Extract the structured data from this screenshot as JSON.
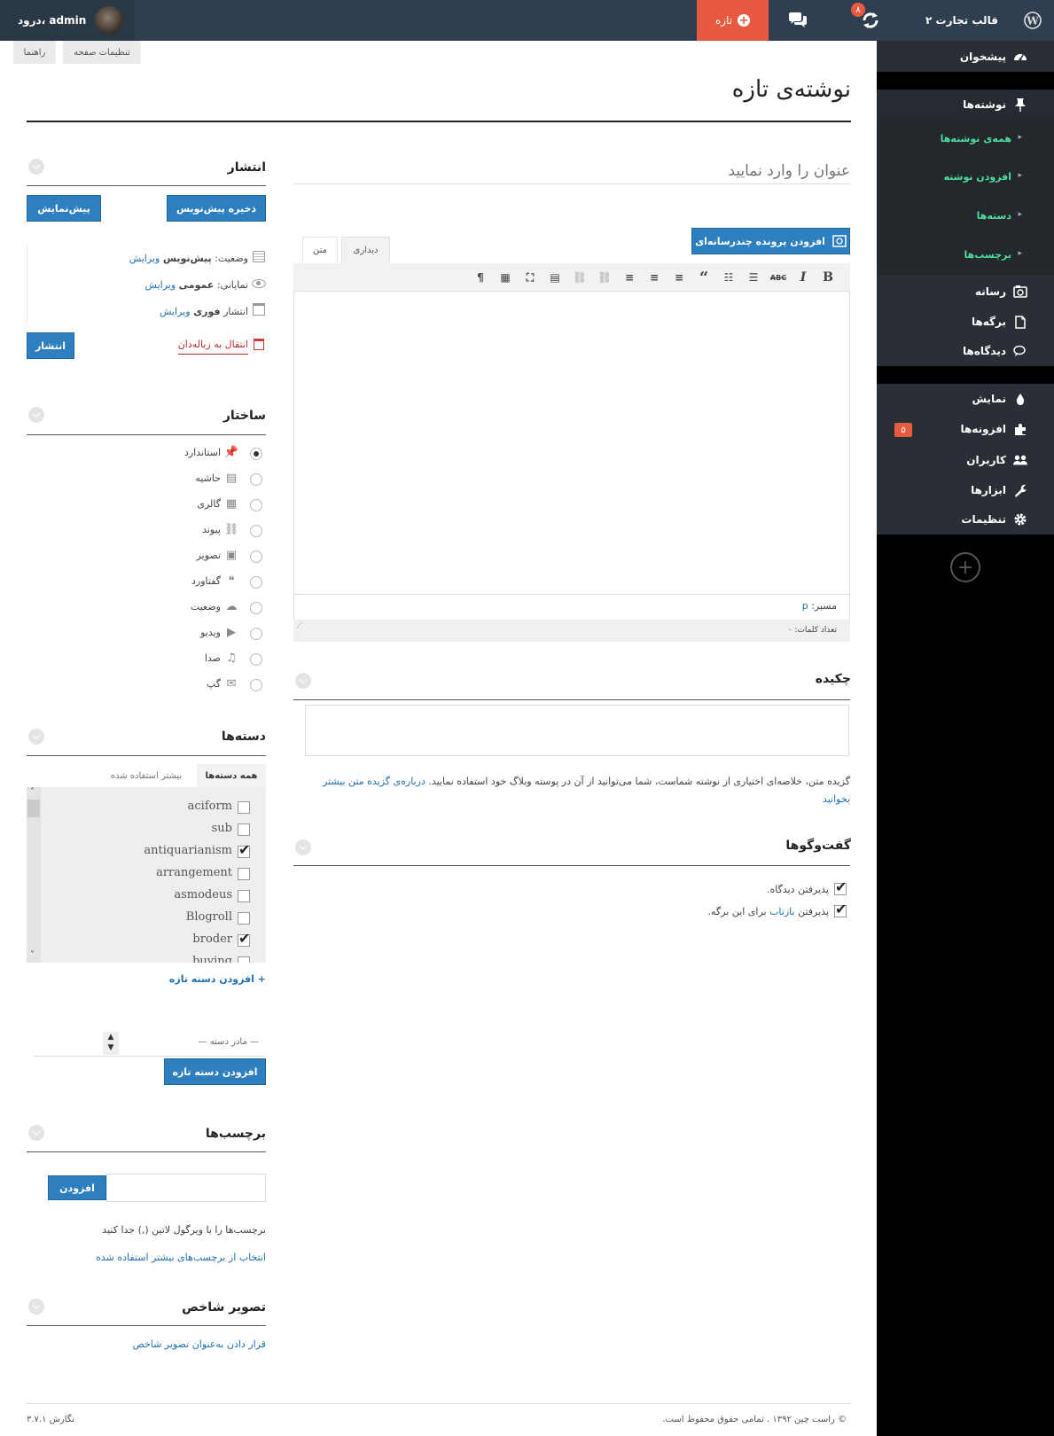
{
  "topbar": {
    "site_name": "قالب تجارت ۲",
    "updates_count": "۸",
    "new_label": "تازه",
    "greeting": "درود، admin"
  },
  "sidebar": {
    "dashboard": "پیشخوان",
    "posts": "نوشته‌ها",
    "posts_sub": [
      "همه‌ی نوشته‌ها",
      "افزودن نوشته",
      "دسته‌ها",
      "برچسب‌ها"
    ],
    "media": "رسانه",
    "pages": "برگه‌ها",
    "comments": "دیدگاه‌ها",
    "appearance": "نمایش",
    "plugins": "افزونه‌ها",
    "plugins_badge": "۵",
    "users": "کاربران",
    "tools": "ابزارها",
    "settings": "تنظیمات"
  },
  "screen_tabs": {
    "options": "تنظیمات صفحه",
    "help": "راهنما"
  },
  "page_title": "نوشته‌ی تازه",
  "editor": {
    "title_placeholder": "عنوان را وارد نمایید",
    "add_media": "افزودن پرونده چندرسانه‌ای",
    "tab_visual": "دیداری",
    "tab_text": "متن",
    "path_label": "مسیر:",
    "path_value": "p",
    "word_count": "تعداد کلمات: ۰"
  },
  "excerpt": {
    "title": "چکیده",
    "help": "گزیده متن، خلاصه‌ای اختیاری از نوشته شماست، شما می‌توانید از آن در پوسته وبلاگ خود استفاده نمایید.",
    "link": "درباره‌ی گزیده متن بیشتر بخوانید"
  },
  "discussion": {
    "title": "گفت‌وگوها",
    "allow_comments": "پذیرفتن دیدگاه.",
    "allow_pings_pre": "پذیرفتن",
    "allow_pings_link": "بازتاب",
    "allow_pings_post": "برای این برگه."
  },
  "publish": {
    "title": "انتشار",
    "save_draft": "ذخیره پیش‌نویس",
    "preview": "پیش‌نمایش",
    "status_label": "وضعیت:",
    "status_value": "پیش‌نویس",
    "visibility_label": "نمایانی:",
    "visibility_value": "عمومی",
    "schedule_label": "انتشار",
    "schedule_value": "فوری",
    "edit": "ویرایش",
    "trash": "انتقال به زباله‌دان",
    "publish_btn": "انتشار"
  },
  "format": {
    "title": "ساختار",
    "options": [
      {
        "label": "استاندارد",
        "icon": "pin-icon",
        "checked": true
      },
      {
        "label": "حاشیه",
        "icon": "aside-icon",
        "checked": false
      },
      {
        "label": "گالری",
        "icon": "gallery-icon",
        "checked": false
      },
      {
        "label": "پیوند",
        "icon": "link-icon",
        "checked": false
      },
      {
        "label": "تصویر",
        "icon": "image-icon",
        "checked": false
      },
      {
        "label": "گفتاورد",
        "icon": "quote-icon",
        "checked": false
      },
      {
        "label": "وضعیت",
        "icon": "status-icon",
        "checked": false
      },
      {
        "label": "ویدیو",
        "icon": "video-icon",
        "checked": false
      },
      {
        "label": "صدا",
        "icon": "audio-icon",
        "checked": false
      },
      {
        "label": "گپ",
        "icon": "chat-icon",
        "checked": false
      }
    ]
  },
  "categories": {
    "title": "دسته‌ها",
    "tab_all": "همه دسته‌ها",
    "tab_popular": "بیشتر استفاده شده",
    "items": [
      {
        "label": "aciform",
        "checked": false
      },
      {
        "label": "sub",
        "checked": false
      },
      {
        "label": "antiquarianism",
        "checked": true
      },
      {
        "label": "arrangement",
        "checked": false
      },
      {
        "label": "asmodeus",
        "checked": false
      },
      {
        "label": "Blogroll",
        "checked": false
      },
      {
        "label": "broder",
        "checked": true
      },
      {
        "label": "buying",
        "checked": false
      }
    ],
    "add_new_link": "+ افزودن دسته تازه",
    "parent_select": "— مادر دسته —",
    "add_new_btn": "افزودن دسته تازه"
  },
  "tags": {
    "title": "برچسب‌ها",
    "add_btn": "افزودن",
    "help": "برچسب‌ها را با ویرگول لاتین (,) جدا کنید",
    "choose_link": "انتخاب از برچسب‌های بیشتر استفاده شده"
  },
  "featured_image": {
    "title": "تصویر شاخص",
    "set_link": "قرار دادن به‌عنوان تصویر شاخص"
  },
  "footer": {
    "copyright": "© راست چین ۱۳۹۲ . تمامی حقوق محفوظ است.",
    "version": "نگارش ۳.۷.۱"
  },
  "colors": {
    "topbar": "#2f3f4f",
    "accent_new": "#e75a3f",
    "button_blue": "#2e7fbf",
    "submenu_green": "#4fdc9d"
  }
}
